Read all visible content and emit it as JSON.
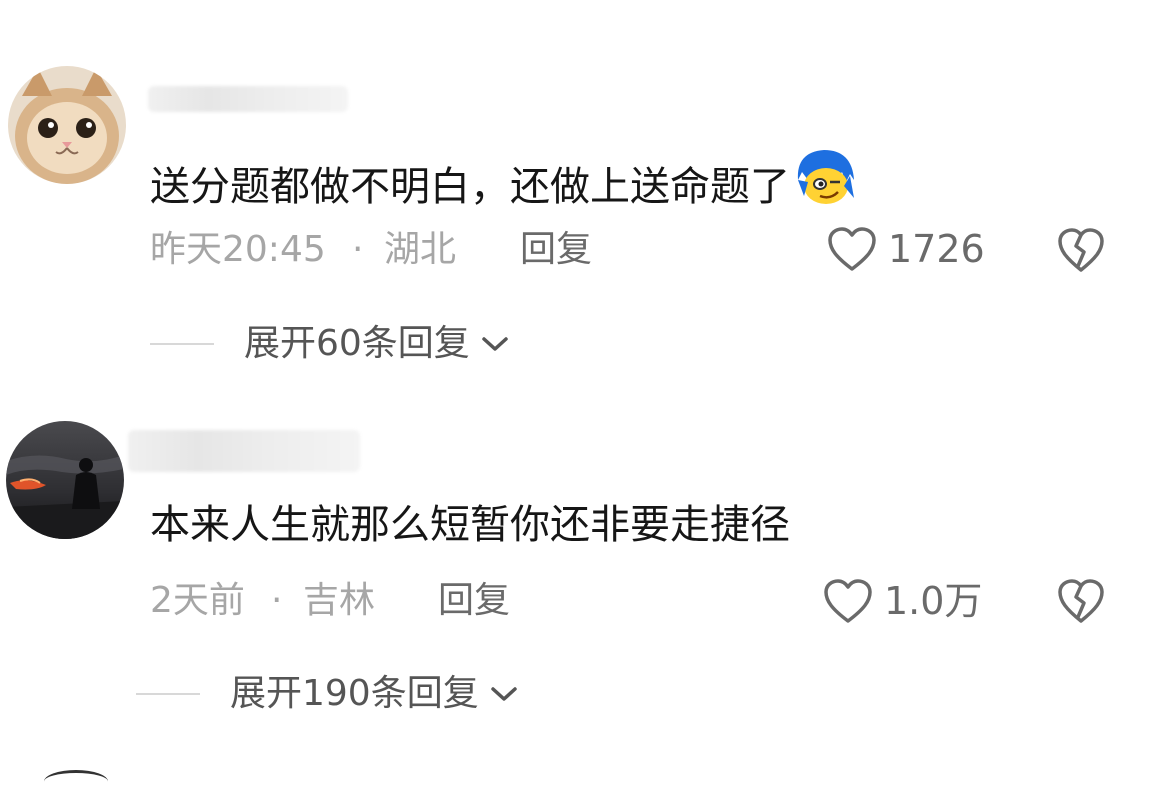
{
  "comments": [
    {
      "text": "送分题都做不明白，还做上送命题了",
      "emoji": "blue-hair-smirk-emoji",
      "time": "昨天20:45",
      "dot": "·",
      "location": "湖北",
      "reply_label": "回复",
      "like_count": "1726",
      "expand_label": "展开60条回复"
    },
    {
      "text": "本来人生就那么短暂你还非要走捷径",
      "time": "2天前",
      "dot": "·",
      "location": "吉林",
      "reply_label": "回复",
      "like_count": "1.0万",
      "expand_label": "展开190条回复"
    }
  ],
  "icons": {
    "like": "heart-outline-icon",
    "dislike": "broken-heart-icon",
    "expand": "chevron-down-icon"
  },
  "colors": {
    "text": "#161616",
    "meta": "#a6a6a6",
    "action": "#6a6a6a"
  }
}
